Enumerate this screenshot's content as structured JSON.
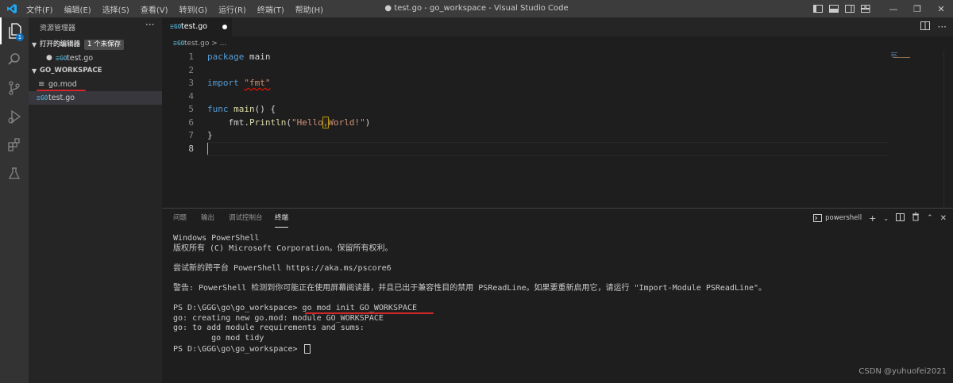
{
  "titlebar": {
    "menu": [
      "文件(F)",
      "编辑(E)",
      "选择(S)",
      "查看(V)",
      "转到(G)",
      "运行(R)",
      "终端(T)",
      "帮助(H)"
    ],
    "title": "● test.go - go_workspace - Visual Studio Code"
  },
  "activity": {
    "items": [
      "explorer-icon",
      "search-icon",
      "source-control-icon",
      "run-debug-icon",
      "extensions-icon",
      "testing-icon"
    ],
    "badge": "1"
  },
  "sidebar": {
    "title": "资源管理器",
    "more": "···",
    "open_editors": {
      "label": "打开的编辑器",
      "unsaved": "1 个未保存",
      "items": [
        {
          "name": "test.go",
          "icon": "go-file-icon"
        }
      ]
    },
    "workspace": {
      "label": "GO_WORKSPACE",
      "files": [
        {
          "name": "go.mod",
          "icon": "≡"
        },
        {
          "name": "test.go",
          "icon": "go-file-icon"
        }
      ]
    }
  },
  "editor": {
    "tab_label": "test.go",
    "breadcrumb_file": "test.go",
    "breadcrumb_rest": "> ...",
    "line_numbers": [
      "1",
      "2",
      "3",
      "4",
      "5",
      "6",
      "7",
      "8"
    ],
    "code": {
      "l1_kw": "package",
      "l1_rest": " main",
      "l3_kw": "import",
      "l3_str": "\"fmt\"",
      "l5_kw": "func",
      "l5_fn": "main",
      "l5_rest": "() {",
      "l6_pre": "    fmt.",
      "l6_fn": "Println",
      "l6_open": "(",
      "l6_str_a": "\"Hello",
      "l6_mark": ",",
      "l6_str_b": "World!\"",
      "l6_close": ")",
      "l7": "}"
    }
  },
  "panel": {
    "tabs": [
      "问题",
      "输出",
      "调试控制台",
      "终端"
    ],
    "active_tab": "终端",
    "shell": "powershell",
    "terminal_lines": [
      "Windows PowerShell",
      "版权所有 (C) Microsoft Corporation。保留所有权利。",
      "",
      "尝试新的跨平台 PowerShell https://aka.ms/pscore6",
      "",
      "警告: PowerShell 检测到你可能正在使用屏幕阅读器，并且已出于兼容性目的禁用 PSReadLine。如果要重新启用它，请运行 \"Import-Module PSReadLine\"。",
      "",
      "PS D:\\GGG\\go\\go_workspace> go mod init GO_WORKSPACE",
      "go: creating new go.mod: module GO_WORKSPACE",
      "go: to add module requirements and sums:",
      "        go mod tidy"
    ],
    "prompt": "PS D:\\GGG\\go\\go_workspace> "
  },
  "watermark": "CSDN @yuhuofei2021"
}
